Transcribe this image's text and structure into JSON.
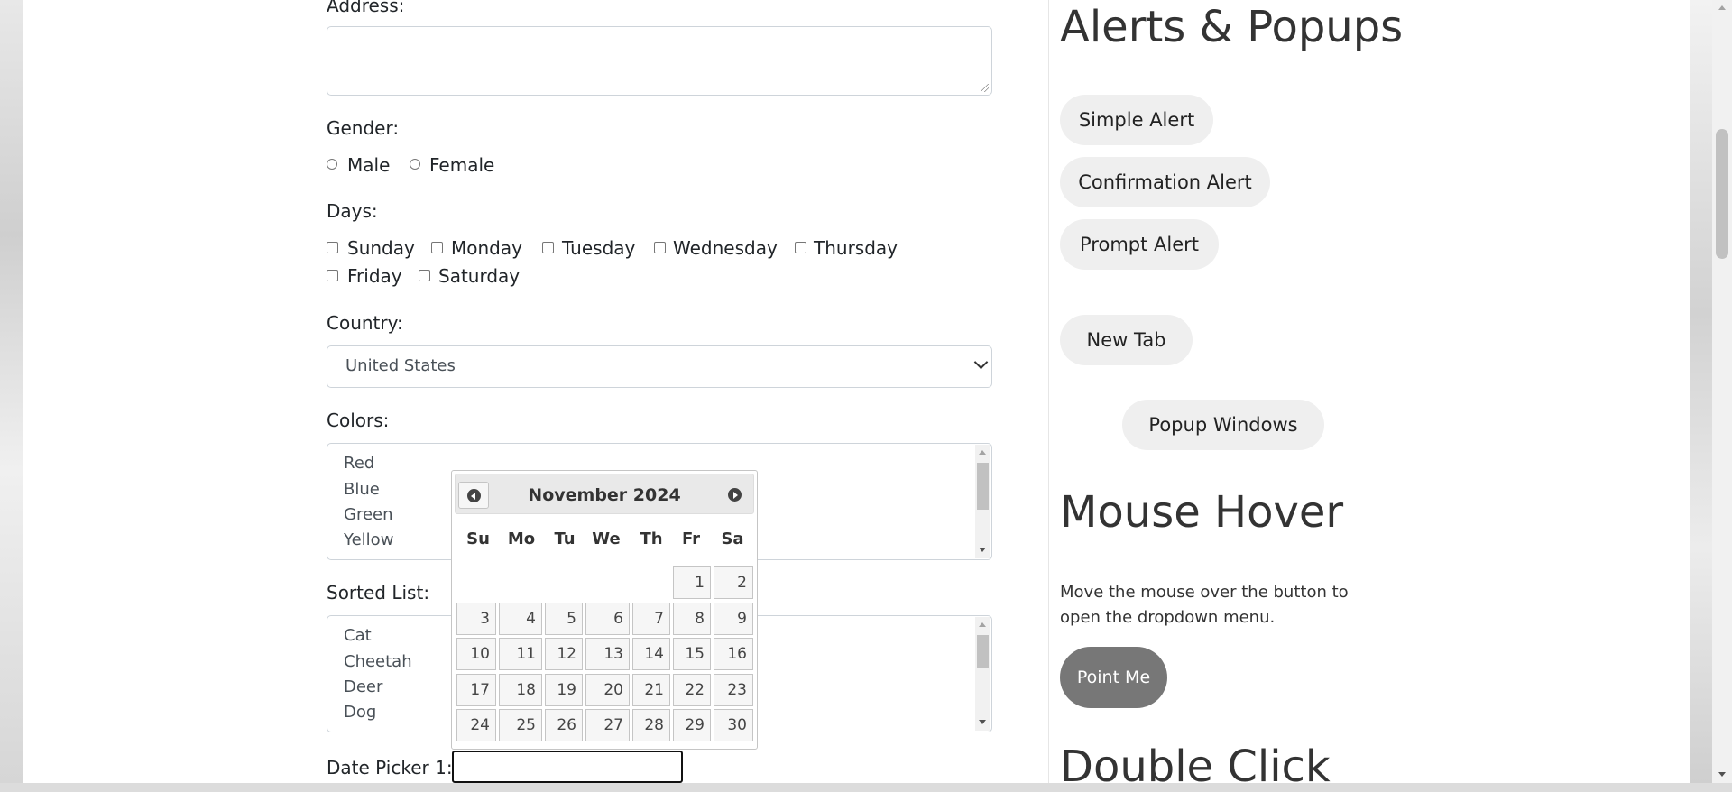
{
  "form": {
    "address_label": "Address:",
    "address_value": "",
    "gender_label": "Gender:",
    "gender_options": [
      "Male",
      "Female"
    ],
    "days_label": "Days:",
    "days_options": [
      "Sunday",
      "Monday",
      "Tuesday",
      "Wednesday",
      "Thursday",
      "Friday",
      "Saturday"
    ],
    "country_label": "Country:",
    "country_value": "United States",
    "colors_label": "Colors:",
    "colors_items": [
      "Red",
      "Blue",
      "Green",
      "Yellow"
    ],
    "sorted_label": "Sorted List:",
    "sorted_items": [
      "Cat",
      "Cheetah",
      "Deer",
      "Dog"
    ],
    "datepicker1_label": "Date Picker 1:",
    "datepicker1_value": ""
  },
  "datepicker": {
    "title": "November 2024",
    "weekdays": [
      "Su",
      "Mo",
      "Tu",
      "We",
      "Th",
      "Fr",
      "Sa"
    ],
    "days": [
      "1",
      "2",
      "3",
      "4",
      "5",
      "6",
      "7",
      "8",
      "9",
      "10",
      "11",
      "12",
      "13",
      "14",
      "15",
      "16",
      "17",
      "18",
      "19",
      "20",
      "21",
      "22",
      "23",
      "24",
      "25",
      "26",
      "27",
      "28",
      "29",
      "30"
    ]
  },
  "alerts": {
    "heading": "Alerts & Popups",
    "simple": "Simple Alert",
    "confirm": "Confirmation Alert",
    "prompt": "Prompt Alert",
    "new_tab": "New Tab",
    "popup": "Popup Windows"
  },
  "hover": {
    "heading": "Mouse Hover",
    "description": "Move the mouse over the button to open the dropdown menu.",
    "button": "Point Me"
  },
  "double_click": {
    "heading": "Double Click"
  },
  "icons": [
    "prev-arrow-icon",
    "next-arrow-icon",
    "chevron-down-icon",
    "scroll-up-icon",
    "scroll-down-icon",
    "resize-grip-icon"
  ]
}
